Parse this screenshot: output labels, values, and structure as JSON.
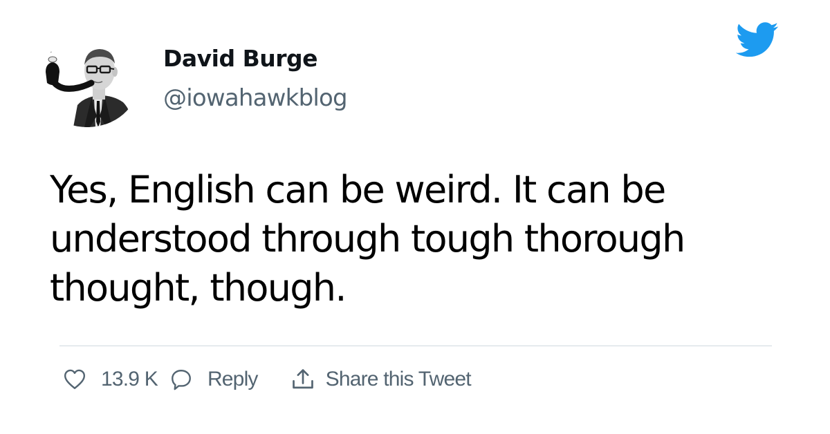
{
  "author": {
    "display_name": "David Burge",
    "handle": "@iowahawkblog",
    "avatar_icon": "avatar-man-with-pipe"
  },
  "tweet": {
    "text": "Yes, English can be weird. It can be understood through tough thorough thought, though."
  },
  "actions": {
    "like_icon": "heart-icon",
    "like_count": "13.9 K",
    "reply_icon": "speech-bubble-icon",
    "reply_label": "Reply",
    "share_icon": "share-upload-icon",
    "share_label": "Share this Tweet"
  },
  "brand": {
    "logo_icon": "twitter-bird-icon",
    "accent_color": "#1d9bf0",
    "muted_text_color": "#536471",
    "divider_color": "#cfd9de"
  }
}
